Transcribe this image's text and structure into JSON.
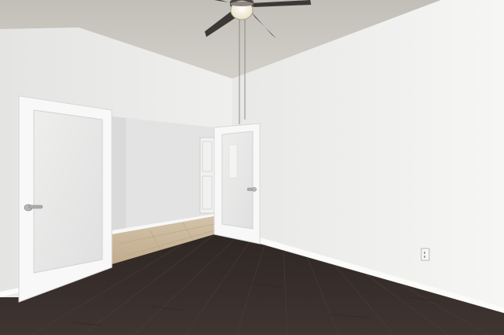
{
  "scene": {
    "colors": {
      "ceiling": "#cdc9c3",
      "wall_right": "#f0f0ef",
      "wall_left": "#ebebea",
      "wall_far": "#e4e5e4",
      "door_frame": "#f8f8f8",
      "door_glass": "#e6e7e6",
      "wood_floor": "#3a312d",
      "tile_floor": "#c9b69a",
      "fan_blade": "#3b3836",
      "fan_light": "#f6f1e2"
    }
  }
}
